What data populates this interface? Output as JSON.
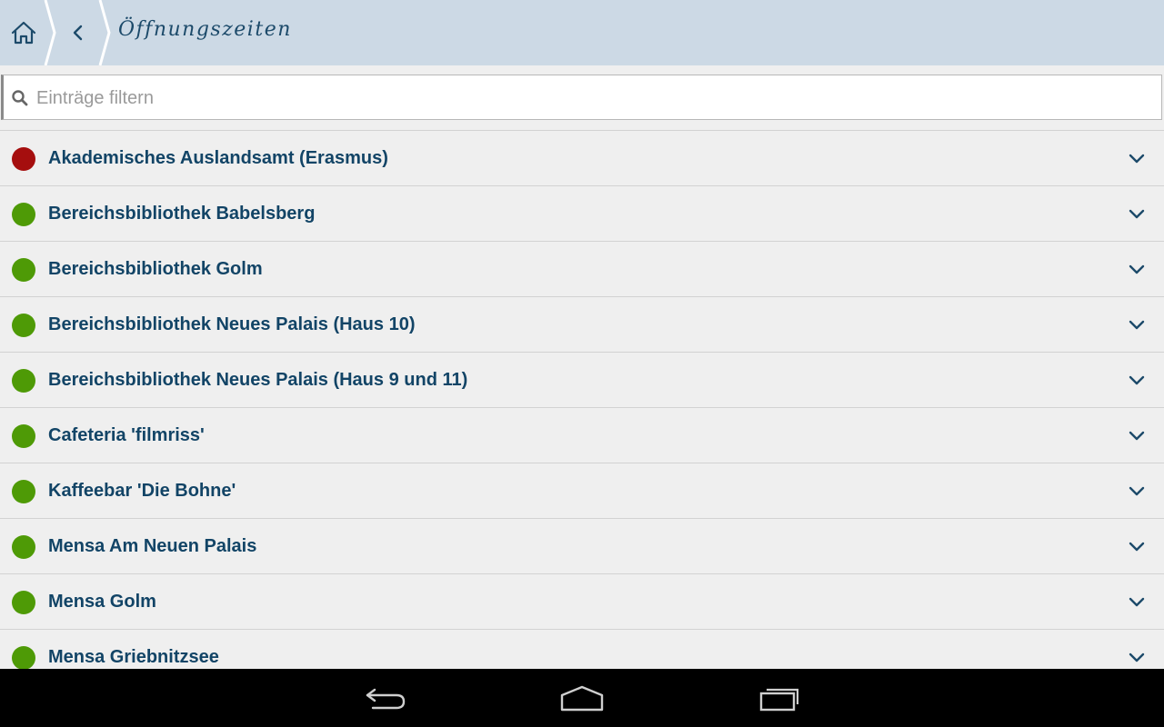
{
  "header": {
    "title": "Öffnungszeiten",
    "home_icon": "home-icon",
    "back_icon": "chevron-left-icon",
    "background": "#ccd9e5",
    "title_color": "#1c4a6a"
  },
  "search": {
    "placeholder": "Einträge filtern",
    "value": "",
    "icon": "search-icon"
  },
  "status_colors": {
    "open": "#4e9a06",
    "closed": "#a50e0e"
  },
  "entries": [
    {
      "label": "Akademisches Auslandsamt (Erasmus)",
      "status": "closed"
    },
    {
      "label": "Bereichsbibliothek Babelsberg",
      "status": "open"
    },
    {
      "label": "Bereichsbibliothek Golm",
      "status": "open"
    },
    {
      "label": "Bereichsbibliothek Neues Palais (Haus 10)",
      "status": "open"
    },
    {
      "label": "Bereichsbibliothek Neues Palais (Haus 9 und 11)",
      "status": "open"
    },
    {
      "label": "Cafeteria 'filmriss'",
      "status": "open"
    },
    {
      "label": "Kaffeebar 'Die Bohne'",
      "status": "open"
    },
    {
      "label": "Mensa Am Neuen Palais",
      "status": "open"
    },
    {
      "label": "Mensa Golm",
      "status": "open"
    },
    {
      "label": "Mensa Griebnitzsee",
      "status": "open"
    }
  ],
  "navbar": {
    "back_icon": "back-arrow-icon",
    "home_icon": "home-outline-icon",
    "recents_icon": "recent-apps-icon"
  }
}
